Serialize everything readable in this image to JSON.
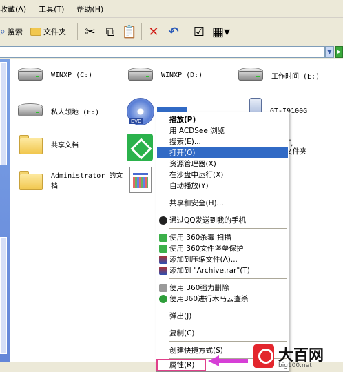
{
  "menubar": {
    "items": [
      "收藏(A)",
      "工具(T)",
      "帮助(H)"
    ]
  },
  "toolbar": {
    "search_label": "搜索",
    "folders_label": "文件夹"
  },
  "drives": {
    "c": "WINXP (C:)",
    "d": "WINXP (D:)",
    "e": "工作时间 (E:)",
    "f": "私人领地 (F:)",
    "phone": "GT-I9100G"
  },
  "folders": {
    "shared": "共享文档",
    "admin_line1": "Administrator 的文",
    "admin_line2": "档",
    "partial1": "机",
    "partial2": "文件夹"
  },
  "context_menu": {
    "items": [
      "播放(P)",
      "用 ACDSee 浏览",
      "搜索(E)...",
      "打开(O)",
      "资源管理器(X)",
      "在沙盘中运行(X)",
      "自动播放(Y)",
      "共享和安全(H)...",
      "通过QQ发送到我的手机",
      "使用 360杀毒 扫描",
      "使用 360文件堡垒保护",
      "添加到压缩文件(A)...",
      "添加到 \"Archive.rar\"(T)",
      "使用 360强力删除",
      "使用360进行木马云查杀",
      "弹出(J)",
      "复制(C)",
      "创建快捷方式(S)",
      "属性(R)"
    ]
  },
  "watermark": {
    "title": "大百网",
    "url": "big100.net"
  },
  "colors": {
    "highlight": "#316ac5",
    "arrow": "#d63fd6",
    "box": "#e0408a"
  }
}
